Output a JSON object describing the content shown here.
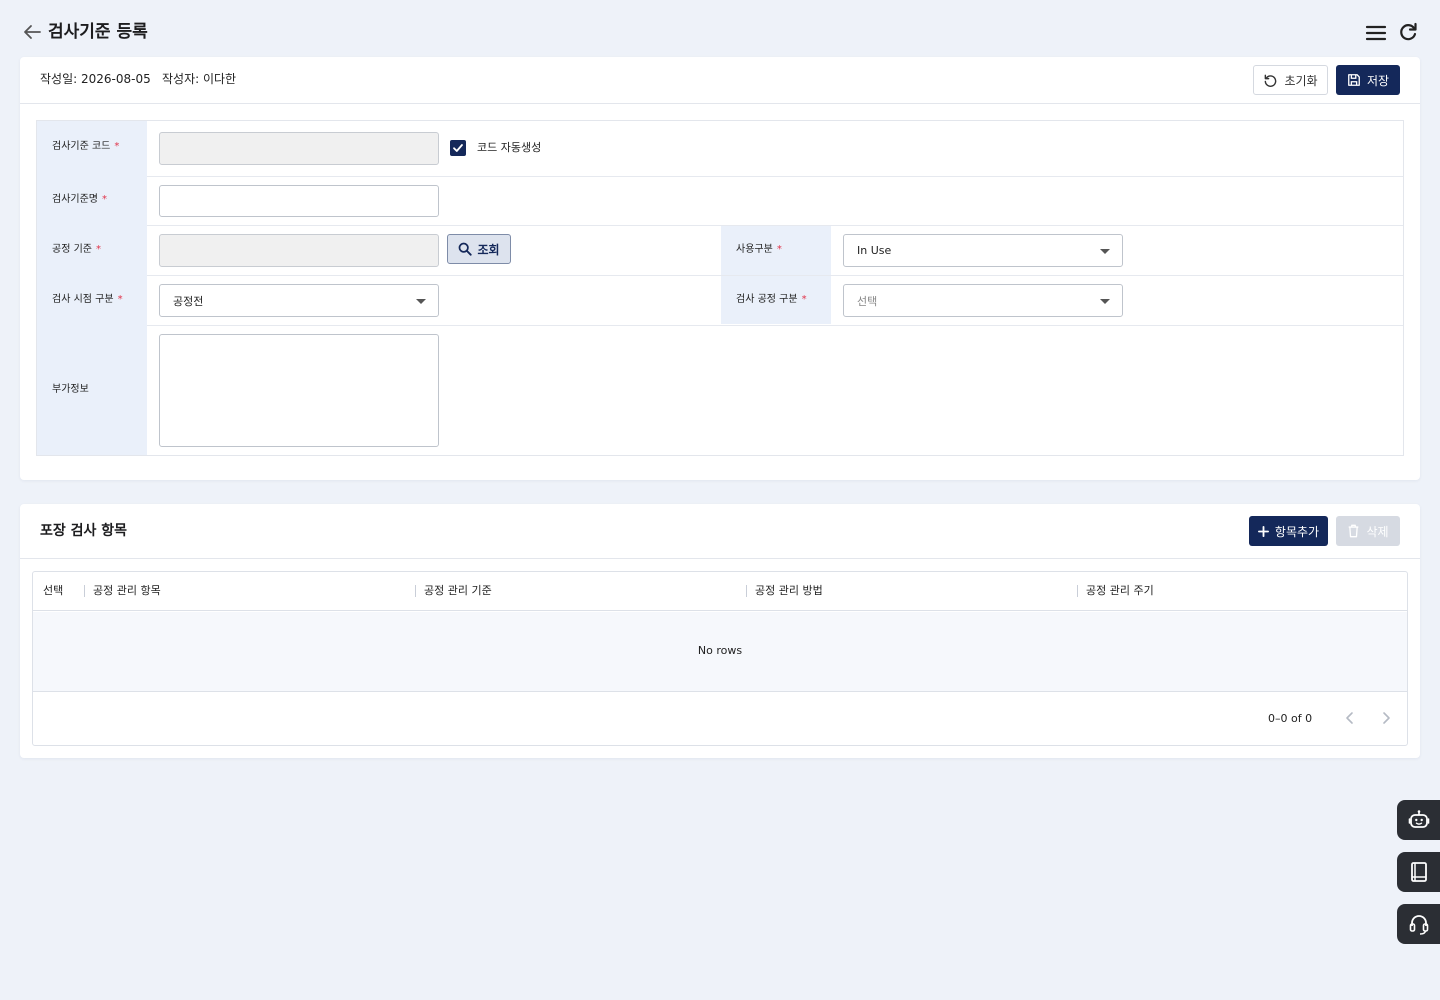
{
  "header": {
    "title": "검사기준 등록",
    "back_icon": "arrow-left-icon",
    "menu_icon": "hamburger-menu-icon",
    "refresh_icon": "refresh-icon"
  },
  "form_card": {
    "created_date": "작성일: 2026-08-05",
    "author": "작성자: 이다한",
    "reset_label": "초기화",
    "save_label": "저장",
    "fields": {
      "code_label": "검사기준 코드",
      "code_value": "",
      "auto_code_label": "코드 자동생성",
      "auto_code_checked": true,
      "name_label": "검사기준명",
      "name_value": "",
      "process_label": "공정 기준",
      "process_value": "",
      "lookup_label": "조회",
      "usage_label": "사용구분",
      "usage_value": "In Use",
      "timing_label": "검사 시점 구분",
      "timing_value": "공정전",
      "process_type_label": "검사 공정 구분",
      "process_type_placeholder": "선택",
      "extra_label": "부가정보",
      "extra_value": ""
    },
    "required_mark": "*"
  },
  "grid_card": {
    "title": "포장 검사 항목",
    "add_label": "항목추가",
    "delete_label": "삭제",
    "columns": [
      "선택",
      "공정 관리 항목",
      "공정 관리 기준",
      "공정 관리 방법",
      "공정 관리 주기"
    ],
    "rows": [],
    "empty_text": "No rows",
    "pagination": "0–0 of 0"
  },
  "side_buttons": [
    "robot-assistant-icon",
    "manual-book-icon",
    "support-headset-icon"
  ],
  "colors": {
    "primary": "#14285a",
    "background": "#eef2f9",
    "label_bg": "#eaf0fa",
    "required": "#e0344a",
    "fab": "#2b2e34"
  }
}
